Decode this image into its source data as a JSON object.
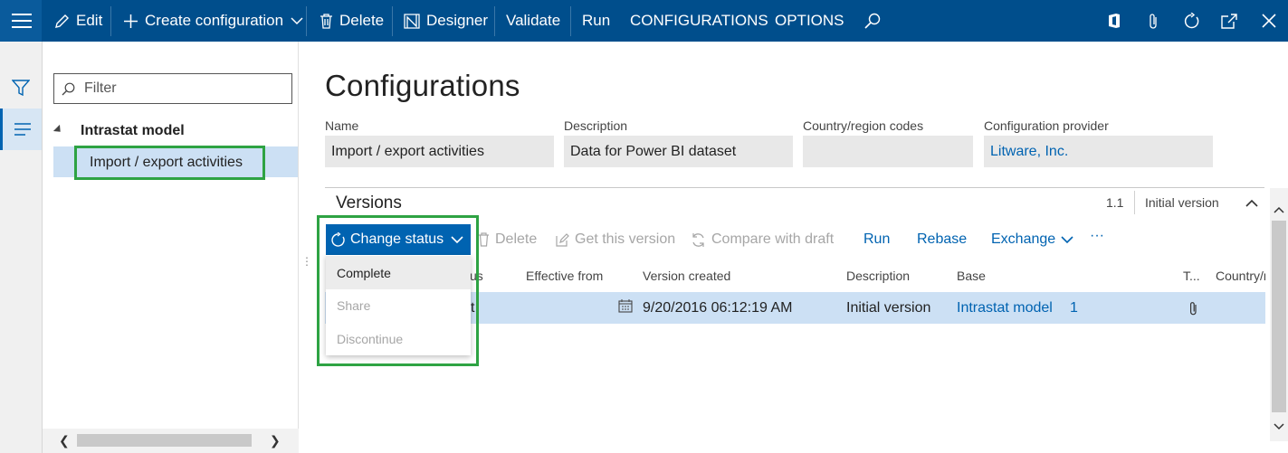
{
  "toolbar": {
    "edit": "Edit",
    "create": "Create configuration",
    "delete": "Delete",
    "designer": "Designer",
    "validate": "Validate",
    "run": "Run",
    "configurations": "CONFIGURATIONS",
    "options": "OPTIONS"
  },
  "tree": {
    "filter_placeholder": "Filter",
    "root": "Intrastat model",
    "selected": "Import / export activities"
  },
  "page": {
    "title": "Configurations",
    "fields": {
      "name_label": "Name",
      "name_value": "Import / export activities",
      "desc_label": "Description",
      "desc_value": "Data for Power BI dataset",
      "country_label": "Country/region codes",
      "country_value": "",
      "provider_label": "Configuration provider",
      "provider_value": "Litware, Inc."
    }
  },
  "versions": {
    "title": "Versions",
    "number": "1.1",
    "name": "Initial version",
    "actions": {
      "change_status": "Change status",
      "delete": "Delete",
      "get_version": "Get this version",
      "compare": "Compare with draft",
      "run": "Run",
      "rebase": "Rebase",
      "exchange": "Exchange",
      "more": "···"
    },
    "columns": [
      "us",
      "Effective from",
      "Version created",
      "Description",
      "Base",
      "T...",
      "Country/r"
    ],
    "row": {
      "status_fragment": "t",
      "version_created": "9/20/2016 06:12:19 AM",
      "description": "Initial version",
      "base": "Intrastat model",
      "base_version": "1"
    },
    "status_menu": [
      "Complete",
      "Share",
      "Discontinue"
    ]
  },
  "colors": {
    "topbar": "#004e8c",
    "accent": "#0063b1",
    "selection": "#cce0f4",
    "highlight": "#2ea343"
  }
}
